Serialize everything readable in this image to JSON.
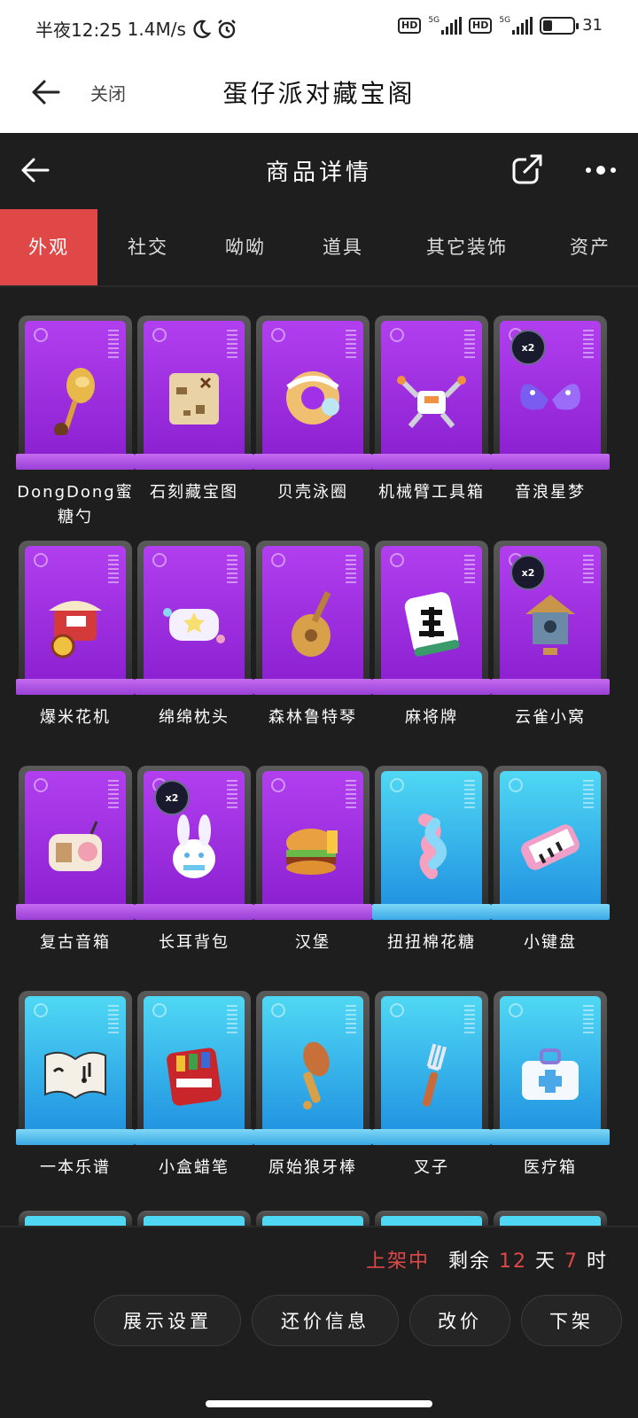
{
  "status_bar": {
    "time": "半夜12:25",
    "speed": "1.4M/s",
    "net1": "5G",
    "net2": "5G",
    "battery": "31"
  },
  "mini_header": {
    "close_label": "关闭",
    "title": "蛋仔派对藏宝阁"
  },
  "app_bar": {
    "title": "商品详情"
  },
  "tabs": [
    "外观",
    "社交",
    "呦呦",
    "道具",
    "其它装饰",
    "资产"
  ],
  "items": [
    {
      "label": "DongDong蜜糖勺",
      "theme": "purple",
      "icon": "spoon-icon",
      "badge": ""
    },
    {
      "label": "石刻藏宝图",
      "theme": "purple",
      "icon": "map-icon",
      "badge": ""
    },
    {
      "label": "贝壳泳圈",
      "theme": "purple",
      "icon": "swim-ring-icon",
      "badge": ""
    },
    {
      "label": "机械臂工具箱",
      "theme": "purple",
      "icon": "robot-arm-toolbox-icon",
      "badge": ""
    },
    {
      "label": "音浪星梦",
      "theme": "purple",
      "icon": "wings-icon",
      "badge": "x2"
    },
    {
      "label": "爆米花机",
      "theme": "purple",
      "icon": "popcorn-cart-icon",
      "badge": ""
    },
    {
      "label": "绵绵枕头",
      "theme": "purple",
      "icon": "pillow-icon",
      "badge": ""
    },
    {
      "label": "森林鲁特琴",
      "theme": "purple",
      "icon": "lute-icon",
      "badge": ""
    },
    {
      "label": "麻将牌",
      "theme": "purple",
      "icon": "mahjong-tile-icon",
      "badge": ""
    },
    {
      "label": "云雀小窝",
      "theme": "purple",
      "icon": "birdhouse-icon",
      "badge": "x2"
    },
    {
      "label": "复古音箱",
      "theme": "purple",
      "icon": "radio-icon",
      "badge": ""
    },
    {
      "label": "长耳背包",
      "theme": "purple",
      "icon": "bunny-backpack-icon",
      "badge": "x2"
    },
    {
      "label": "汉堡",
      "theme": "purple",
      "icon": "burger-icon",
      "badge": ""
    },
    {
      "label": "扭扭棉花糖",
      "theme": "blue",
      "icon": "marshmallow-icon",
      "badge": ""
    },
    {
      "label": "小键盘",
      "theme": "blue",
      "icon": "keyboard-icon",
      "badge": ""
    },
    {
      "label": "一本乐谱",
      "theme": "blue",
      "icon": "music-book-icon",
      "badge": ""
    },
    {
      "label": "小盒蜡笔",
      "theme": "blue",
      "icon": "crayon-box-icon",
      "badge": ""
    },
    {
      "label": "原始狼牙棒",
      "theme": "blue",
      "icon": "club-icon",
      "badge": ""
    },
    {
      "label": "叉子",
      "theme": "blue",
      "icon": "fork-icon",
      "badge": ""
    },
    {
      "label": "医疗箱",
      "theme": "blue",
      "icon": "medkit-icon",
      "badge": ""
    }
  ],
  "listing": {
    "status": "上架中",
    "remaining_prefix": "剩余",
    "days": "12",
    "day_unit": "天",
    "hours": "7",
    "hour_unit": "时"
  },
  "actions": {
    "display_settings": "展示设置",
    "bargain_info": "还价信息",
    "change_price": "改价",
    "delist": "下架"
  },
  "colors": {
    "accent_red": "#e04747",
    "purple": "#a131e8",
    "blue": "#35b6ec"
  }
}
